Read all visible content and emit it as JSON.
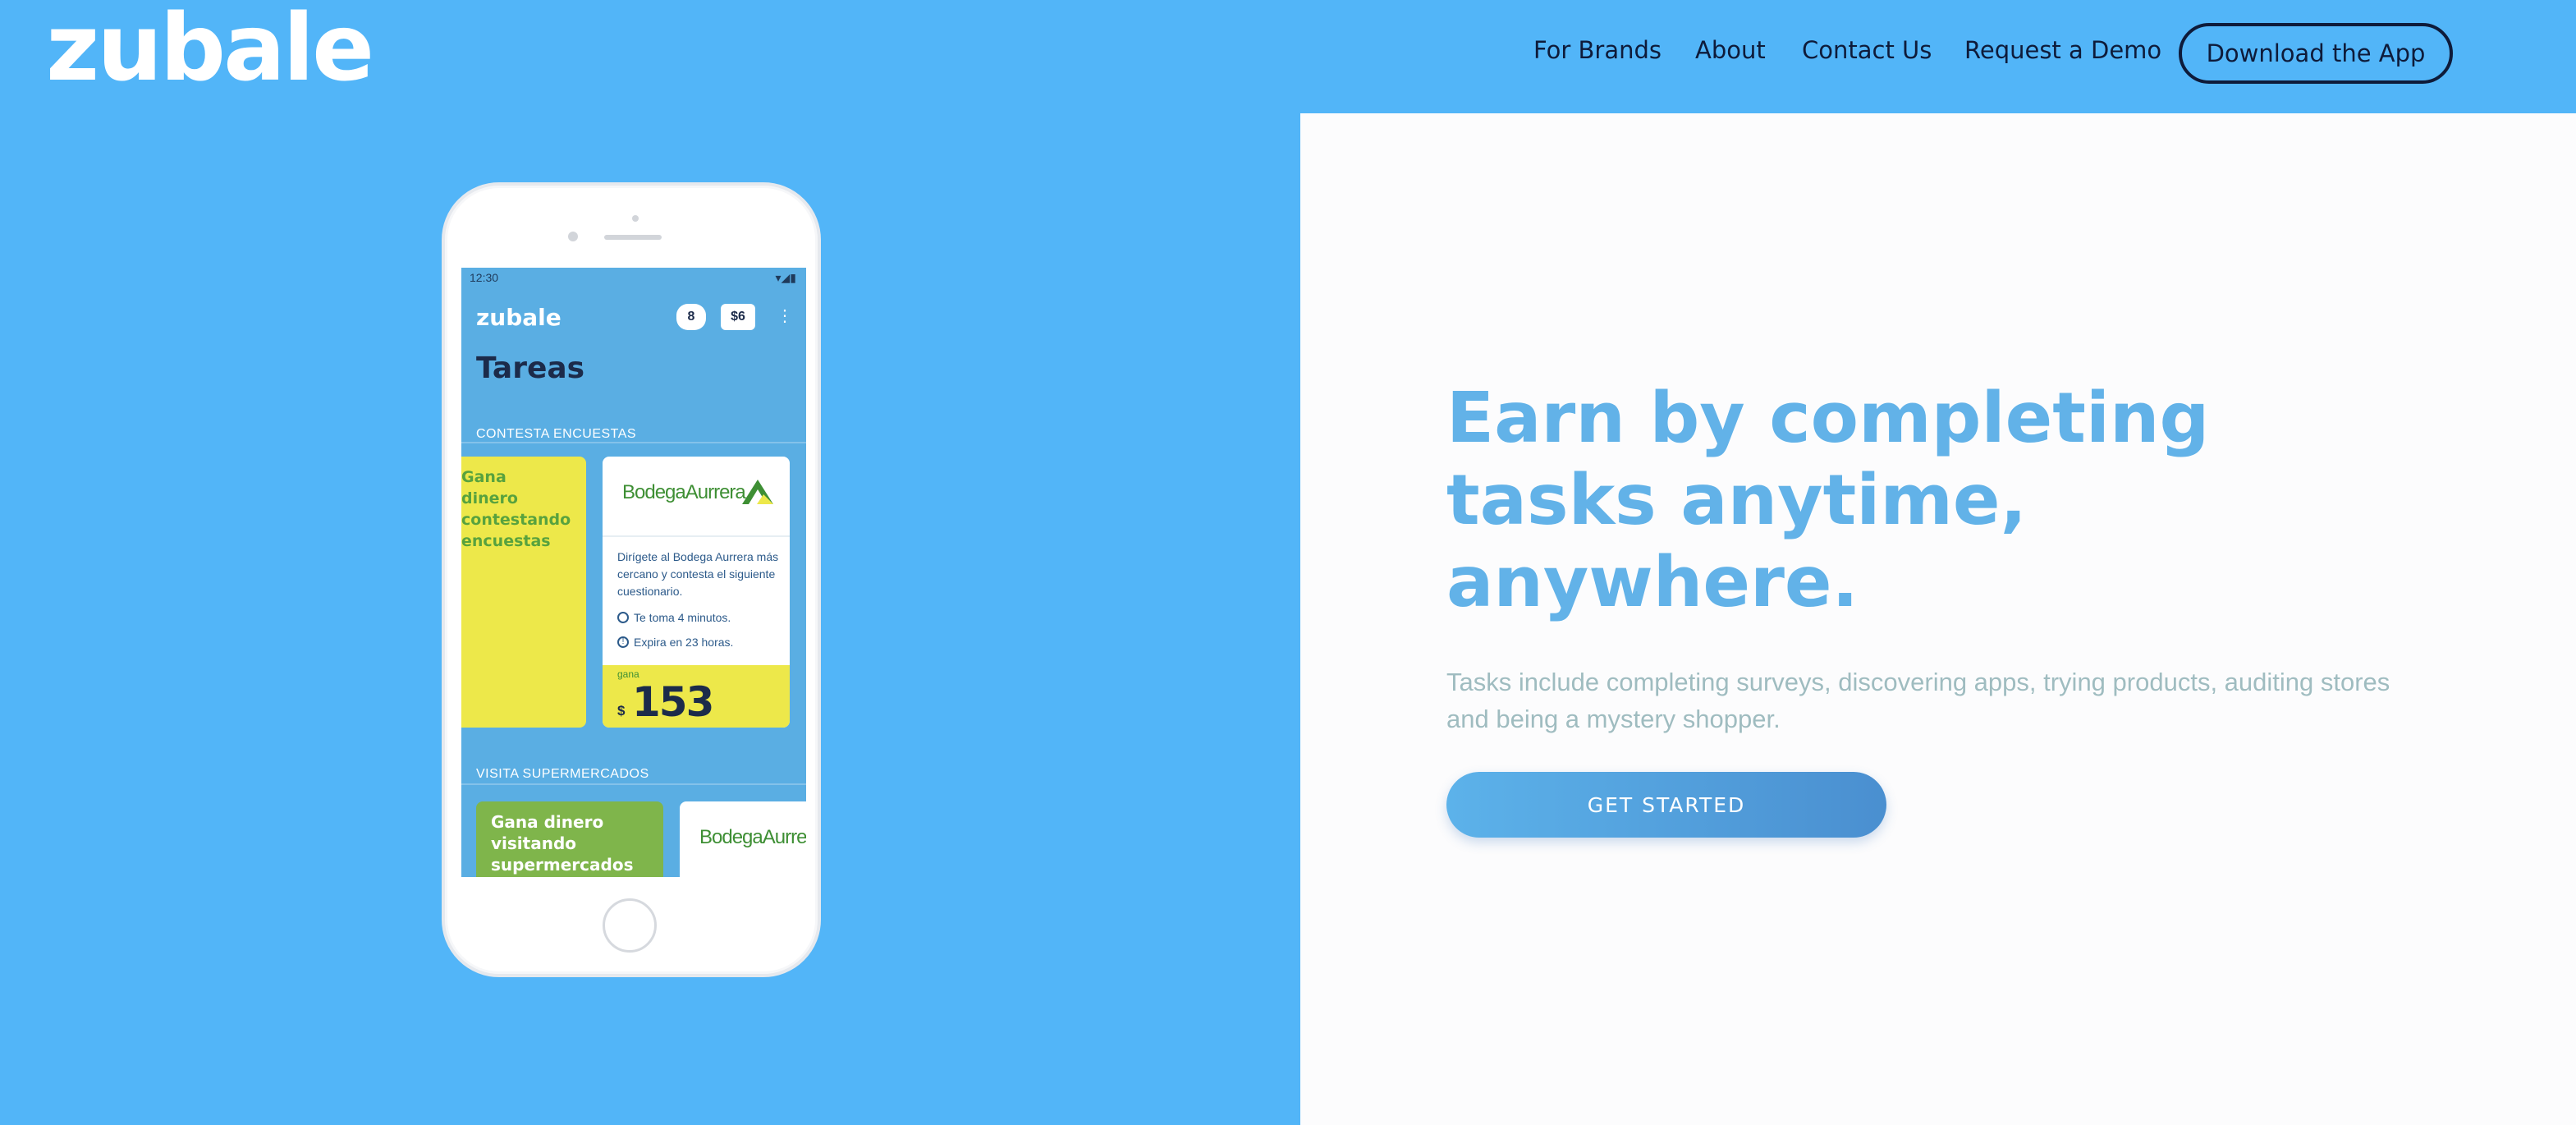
{
  "header": {
    "logo": "zubale",
    "nav": [
      {
        "label": "For Brands"
      },
      {
        "label": "About"
      },
      {
        "label": "Contact Us"
      },
      {
        "label": "Request a Demo"
      }
    ],
    "download_label": "Download the App"
  },
  "hero": {
    "headline_lines": [
      "Earn by completing",
      "tasks anytime,",
      "anywhere."
    ],
    "subtext": "Tasks include completing surveys, discovering apps, trying products, auditing stores and being a mystery shopper.",
    "cta_label": "GET STARTED"
  },
  "phone_screen": {
    "time": "12:30",
    "status_icons": "▾◢▮",
    "app_logo": "zubale",
    "hearts": "8",
    "balance": "$6",
    "title": "Tareas",
    "section1": "CONTESTA ENCUESTAS",
    "yellow_card_text": "Gana dinero contestando encuestas",
    "task": {
      "brand": "BodegaAurrera",
      "description": "Dirígete al Bodega Aurrera más cercano y contesta el siguiente cuestionario.",
      "duration": "Te toma 4 minutos.",
      "expires": "Expira en 23 horas.",
      "gana": "gana",
      "currency": "$",
      "amount": "153"
    },
    "section2": "VISITA SUPERMERCADOS",
    "green_card_text": "Gana dinero visitando supermercados",
    "brand2": "BodegaAurrera"
  },
  "colors": {
    "background": "#52b5f8",
    "panel": "#fcfcfd",
    "headline": "#62b2e8",
    "subtext": "#9fbcc0",
    "dark": "#0e1b3a",
    "brand_green": "#3e8f34",
    "brand_yellow": "#ede84a"
  },
  "icons": [
    "heart-icon",
    "dollar-icon",
    "kebab-menu-icon",
    "timer-icon",
    "alert-icon",
    "bodega-aurrera-logo-icon",
    "wifi-icon",
    "signal-icon",
    "battery-icon"
  ]
}
